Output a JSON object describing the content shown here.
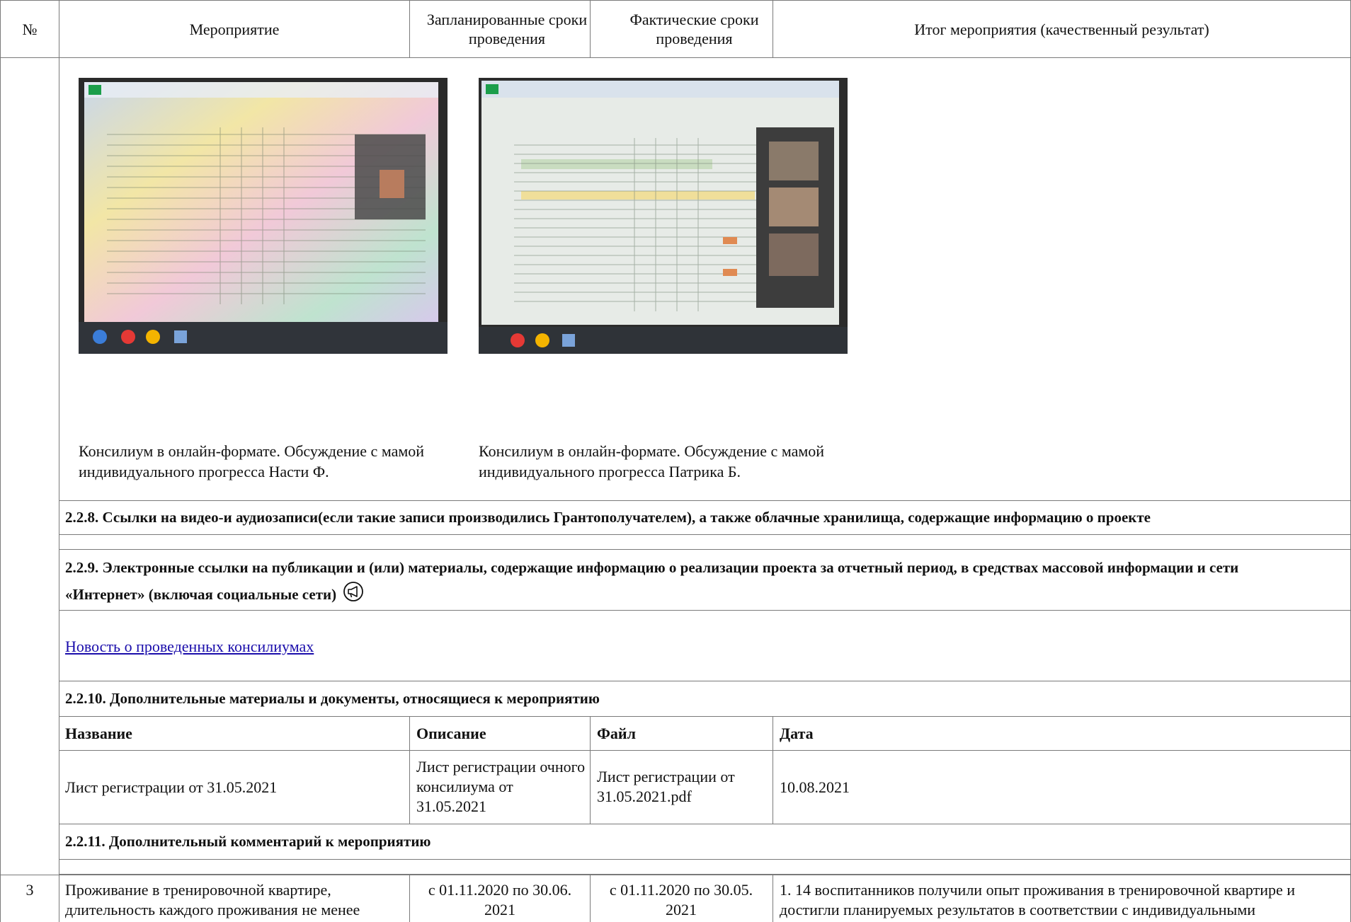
{
  "header": {
    "num": "№",
    "event": "Мероприятие",
    "planned": "Запланированные сроки проведения",
    "actual": "Фактические сроки проведения",
    "result": "Итог мероприятия (качественный результат)"
  },
  "photos": [
    {
      "caption": "Консилиум в онлайн-формате. Обсуждение с мамой индивидуального прогресса Насти Ф.",
      "alt_icon": "spreadsheet-photo"
    },
    {
      "caption": "Консилиум в онлайн-формате. Обсуждение с мамой индивидуального прогресса Патрика Б.",
      "alt_icon": "spreadsheet-photo"
    }
  ],
  "sections": {
    "s228": "2.2.8. Ссылки на видео-и аудиозаписи(если такие записи производились Грантополучателем), а также облачные хранилища, содержащие информацию о проекте",
    "s229": "2.2.9. Электронные ссылки на публикации и (или) материалы, содержащие информацию о реализации проекта за отчетный период, в средствах массовой информации и сети «Интернет» (включая социальные сети)",
    "s229_icon": "megaphone-icon",
    "link": "Новость о проведенных консилиумах",
    "s2210": "2.2.10. Дополнительные материалы и документы, относящиеся к мероприятию",
    "s2211": "2.2.11. Дополнительный комментарий к мероприятию"
  },
  "docs_table": {
    "headers": [
      "Название",
      "Описание",
      "Файл",
      "Дата"
    ],
    "row": {
      "name": "Лист регистрации от 31.05.2021",
      "desc": "Лист регистрации очного консилиума от 31.05.2021",
      "file": "Лист регистрации от 31.05.2021.pdf",
      "date": "10.08.2021"
    }
  },
  "row3": {
    "num": "3",
    "event": "Проживание в тренировочной квартире, длительность каждого проживания не менее",
    "planned": "с 01.11.2020 по 30.06. 2021",
    "actual": "с 01.11.2020 по 30.05. 2021",
    "result": "1. 14 воспитанников получили опыт проживания в тренировочной квартире и достигли планируемых результатов в соответствии с индивидуальными"
  }
}
